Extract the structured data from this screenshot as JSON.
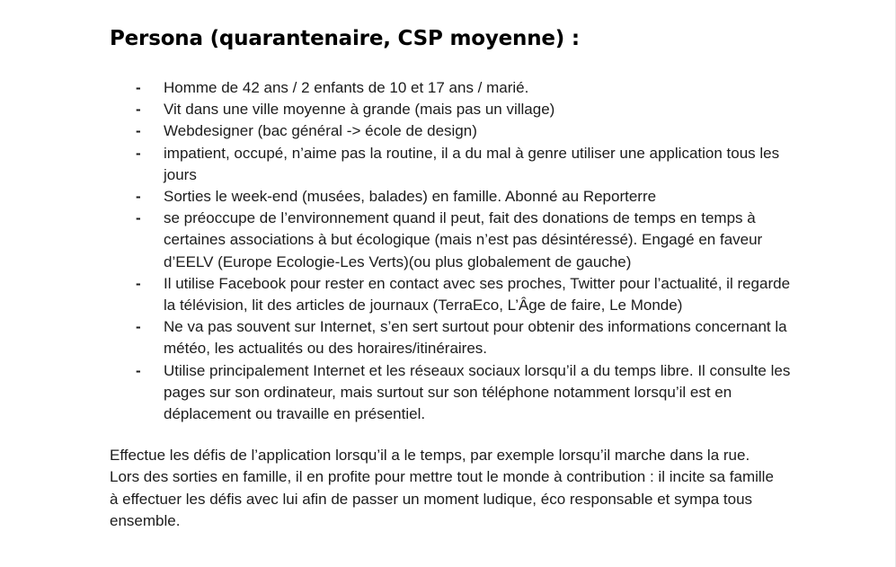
{
  "document": {
    "title": "Persona (quarantenaire, CSP moyenne) :",
    "bullet_marker": "-",
    "bullets": [
      "Homme de 42 ans / 2 enfants de 10 et 17 ans / marié.",
      "Vit dans une ville moyenne à grande (mais pas un village)",
      "Webdesigner (bac général -> école de design)",
      "impatient, occupé, n’aime pas la routine, il a du mal à genre utiliser une application tous les jours",
      "Sorties le week-end (musées, balades) en famille. Abonné au Reporterre",
      "se préoccupe de l’environnement quand il peut, fait des donations de temps en temps à certaines associations à but écologique (mais n’est pas désintéressé). Engagé en faveur d’EELV (Europe Ecologie-Les Verts)(ou plus globalement de gauche)",
      "Il utilise Facebook pour rester en contact avec ses proches, Twitter pour l’actualité, il regarde la télévision, lit des articles de journaux (TerraEco, L’Âge de faire, Le Monde)",
      "Ne va pas souvent sur Internet, s’en sert surtout pour obtenir des informations concernant la météo, les actualités ou des horaires/itinéraires.",
      "Utilise principalement Internet et les réseaux sociaux lorsqu’il a du temps libre. Il consulte les pages sur son ordinateur, mais surtout sur son téléphone notamment lorsqu’il est en déplacement ou travaille en présentiel."
    ],
    "paragraph": "Effectue les défis de l’application lorsqu’il a le temps, par exemple lorsqu’il marche dans la rue. Lors des sorties en famille, il en profite pour mettre tout le monde à contribution : il incite sa famille à effectuer les défis avec lui afin de passer un moment ludique, éco responsable et sympa tous ensemble."
  }
}
